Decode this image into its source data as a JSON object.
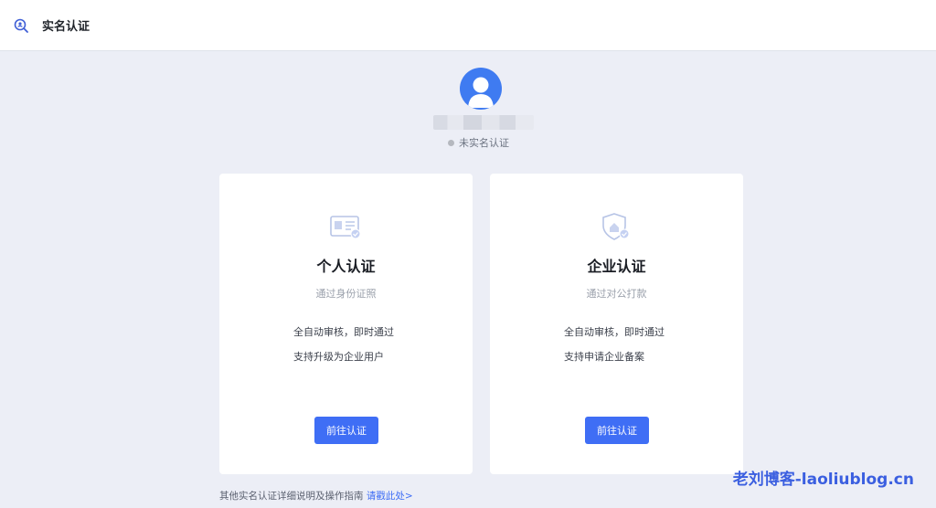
{
  "header": {
    "title": "实名认证",
    "icon": "search-badge-icon"
  },
  "profile": {
    "status": "未实名认证",
    "status_color": "#b5b8bf",
    "avatar_color": "#3f7bf1"
  },
  "cards": [
    {
      "title": "个人认证",
      "subtitle": "通过身份证照",
      "features": [
        "全自动审核，即时通过",
        "支持升级为企业用户"
      ],
      "button": "前往认证",
      "icon": "id-card-icon"
    },
    {
      "title": "企业认证",
      "subtitle": "通过对公打款",
      "features": [
        "全自动审核，即时通过",
        "支持申请企业备案"
      ],
      "button": "前往认证",
      "icon": "enterprise-shield-icon"
    }
  ],
  "footer": {
    "text": "其他实名认证详细说明及操作指南",
    "link": "请戳此处>"
  },
  "watermark": "老刘博客-laoliublog.cn",
  "colors": {
    "accent": "#3f6ef5",
    "background": "#eceef6"
  }
}
